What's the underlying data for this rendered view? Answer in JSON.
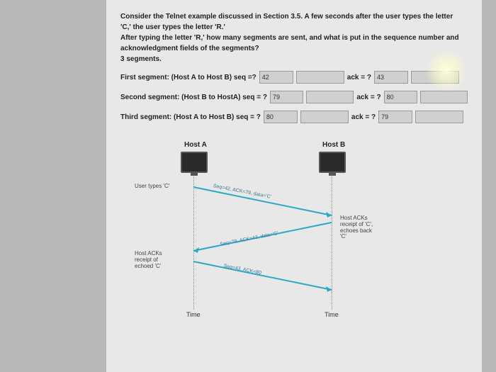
{
  "question": {
    "line1": "Consider the Telnet example discussed in Section 3.5. A few seconds after the user types the letter",
    "line2": "'C,' the user types the letter 'R.'",
    "line3": "After typing the letter 'R,' how many segments are sent, and what is put in the sequence number and",
    "line4": "acknowledgment fields of the segments?",
    "answer_count": "3 segments."
  },
  "segments": [
    {
      "label": "First segment: (Host A to Host B) seq =?",
      "seq": "42",
      "ack_label": "ack = ?",
      "ack": "43"
    },
    {
      "label": "Second segment: (Host B to HostA)  seq = ?",
      "seq": "79",
      "ack_label": "ack = ?",
      "ack": "80"
    },
    {
      "label": "Third segment: (Host A to Host B) seq = ?",
      "seq": "80",
      "ack_label": "ack = ?",
      "ack": "79"
    }
  ],
  "diagram": {
    "hostA": "Host A",
    "hostB": "Host B",
    "user_types": "User types 'C'",
    "hostB_note": "Host ACKs receipt of 'C', echoes back 'C'",
    "hostA_note": "Host ACKs receipt of echoed 'C'",
    "msg1": "Seq=42, ACK=79, data='C'",
    "msg2": "Seq=79, ACK=43, data='C'",
    "msg3": "Seq=43, ACK=80",
    "time": "Time"
  }
}
